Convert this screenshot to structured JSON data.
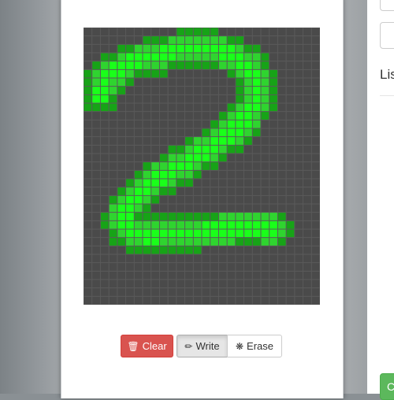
{
  "canvas": {
    "grid_cols": 28,
    "grid_rows": 33,
    "background_color": "#4a4a4a",
    "grid_line_color": "#5a5a5a",
    "ink_colors": [
      "#17a317",
      "#2fd42f",
      "#1aff1a"
    ],
    "drawn_digit": "2"
  },
  "toolbar": {
    "clear_label": "Clear",
    "clear_icon": "trash-icon",
    "write_label": "Write",
    "write_icon": "pencil-icon",
    "erase_label": "Erase",
    "erase_icon": "asterisk-icon",
    "active_mode": "write"
  },
  "right_panel": {
    "heading": "Lis",
    "button_label": "C",
    "accent_color": "#5cb85c"
  }
}
